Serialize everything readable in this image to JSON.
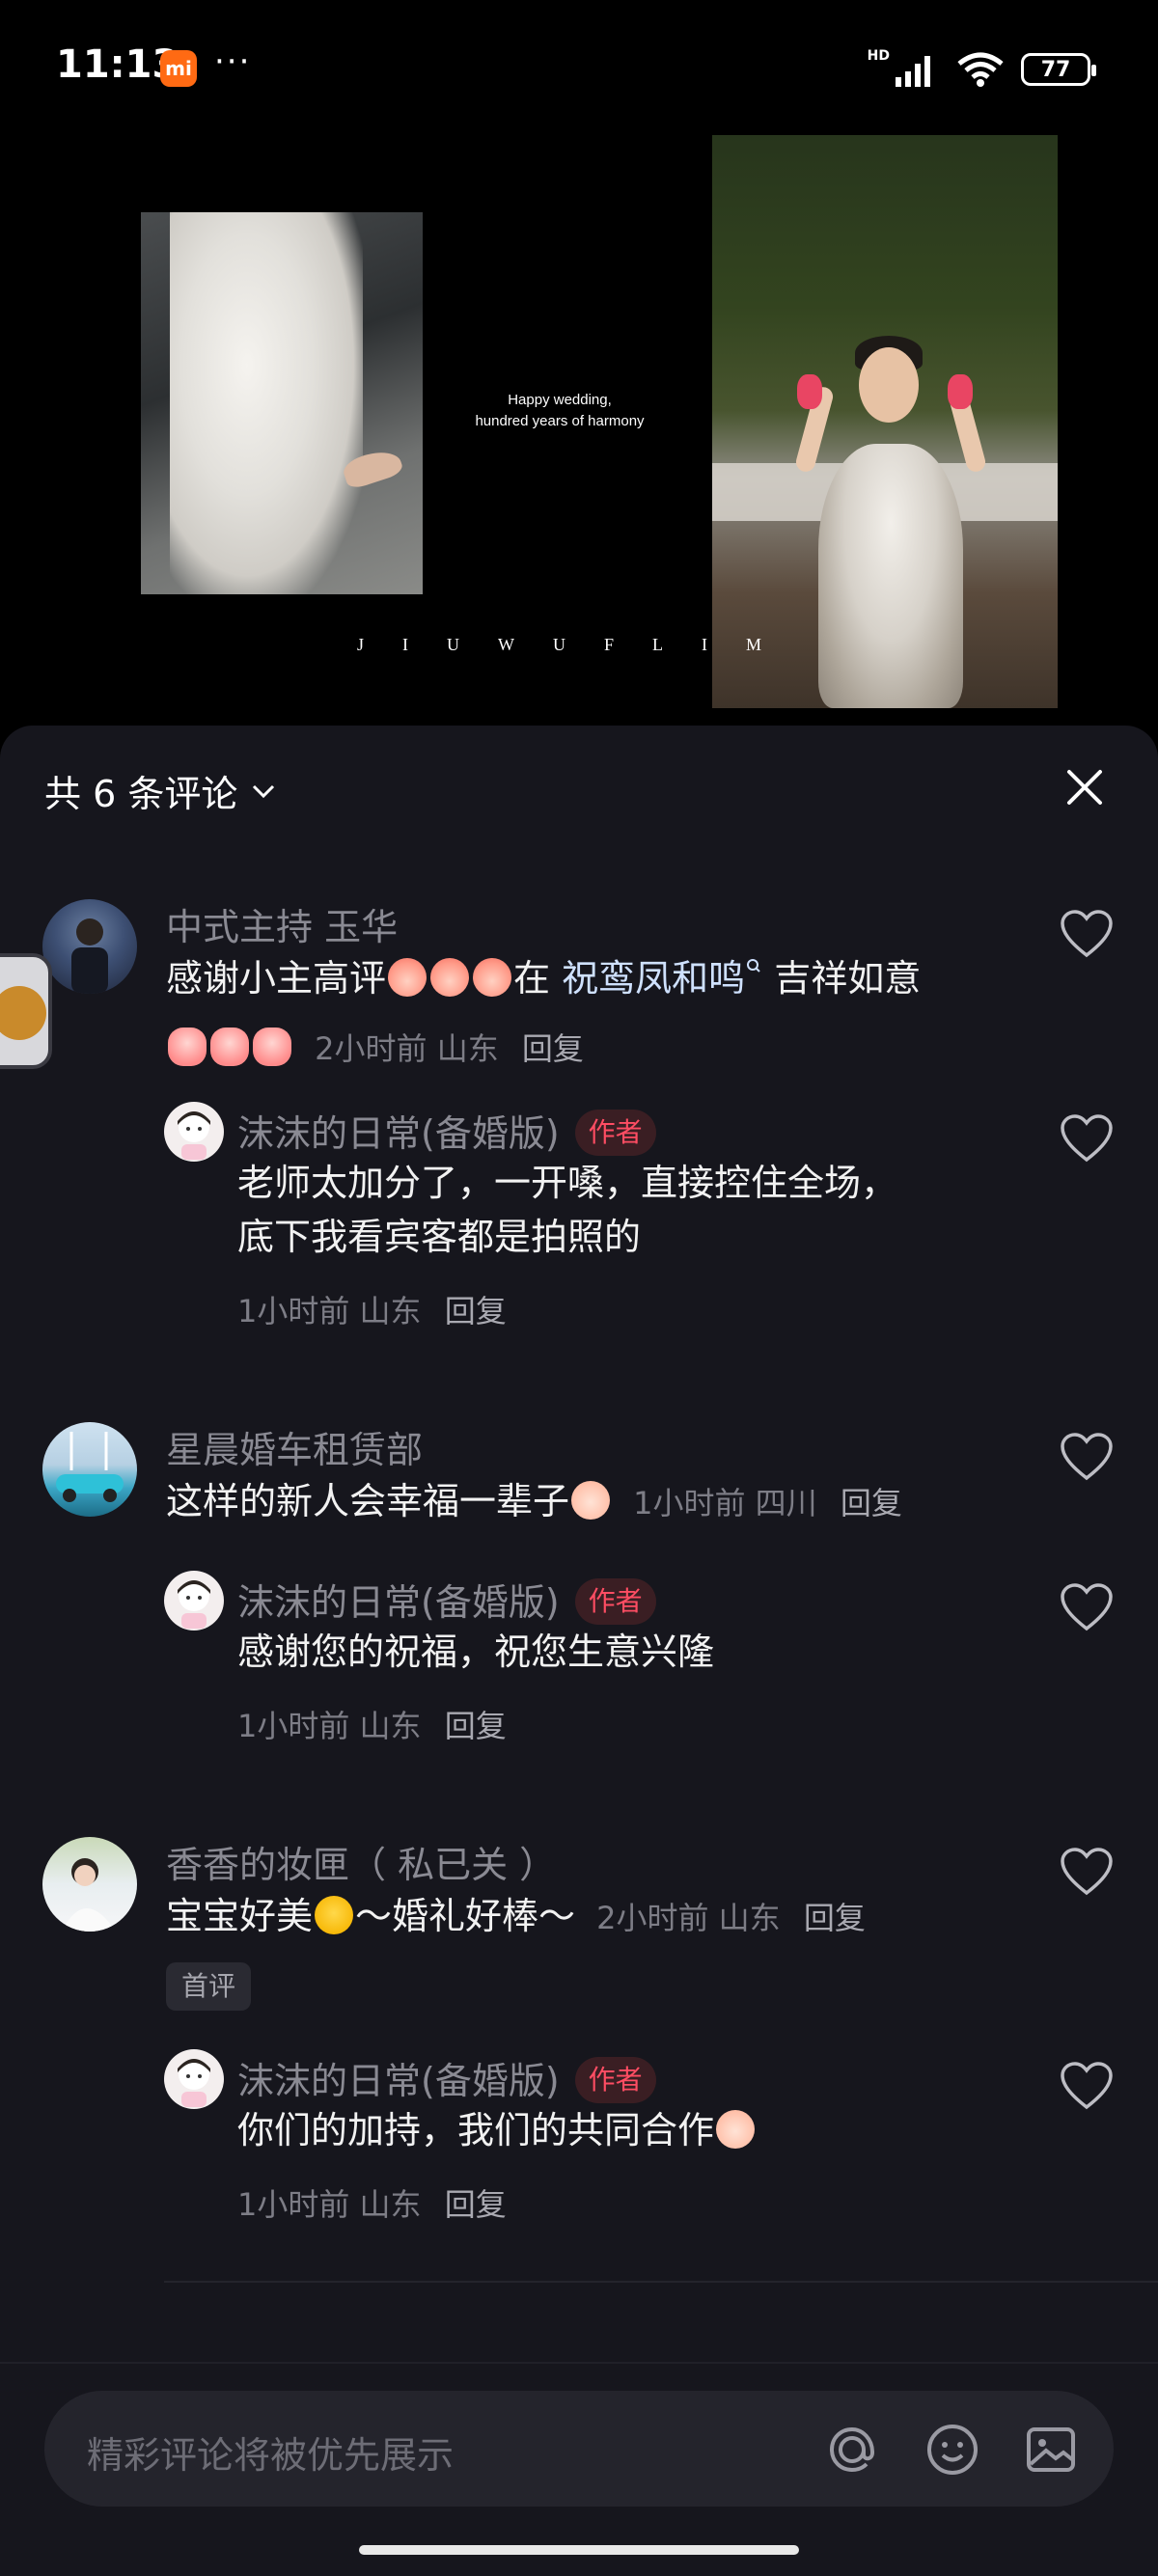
{
  "status_bar": {
    "time": "11:13",
    "app_icon_label": "mi",
    "dots": "···",
    "network": "HD",
    "battery": "77"
  },
  "media": {
    "caption_line1": "Happy wedding,",
    "caption_line2": "hundred years of harmony",
    "brand_letters": "JIUWUFLIM"
  },
  "sheet": {
    "title": "共 6 条评论",
    "close_icon": "close-icon"
  },
  "comments": [
    {
      "name": "中式主持 玉华",
      "text_prefix": "感谢小主高评",
      "text_mid": "在",
      "text_link": "祝鸾凤和鸣",
      "text_suffix": "吉祥如意",
      "time": "2小时前",
      "location": "山东",
      "reply_label": "回复",
      "reply": {
        "name": "沫沫的日常(备婚版)",
        "badge": "作者",
        "line1": "老师太加分了，一开嗓，直接控住全场，",
        "line2": "底下我看宾客都是拍照的",
        "time": "1小时前",
        "location": "山东",
        "reply_label": "回复"
      }
    },
    {
      "name": "星晨婚车租赁部",
      "text": "这样的新人会幸福一辈子",
      "time": "1小时前",
      "location": "四川",
      "reply_label": "回复",
      "reply": {
        "name": "沫沫的日常(备婚版)",
        "badge": "作者",
        "line1": "感谢您的祝福，祝您生意兴隆",
        "time": "1小时前",
        "location": "山东",
        "reply_label": "回复"
      }
    },
    {
      "name": "香香的妆匣（ 私已关 ）",
      "text_a": "宝宝好美",
      "text_b": "～婚礼好棒～",
      "time": "2小时前",
      "location": "山东",
      "reply_label": "回复",
      "tag": "首评",
      "reply": {
        "name": "沫沫的日常(备婚版)",
        "badge": "作者",
        "line1": "你们的加持，我们的共同合作",
        "time": "1小时前",
        "location": "山东",
        "reply_label": "回复"
      }
    }
  ],
  "input_bar": {
    "placeholder": "精彩评论将被优先展示",
    "icons": [
      "at-icon",
      "emoji-icon",
      "image-icon"
    ]
  },
  "colors": {
    "sheet_bg": "#16161d",
    "author_badge": "#ff4d63",
    "muted_text": "#8a8a93"
  }
}
